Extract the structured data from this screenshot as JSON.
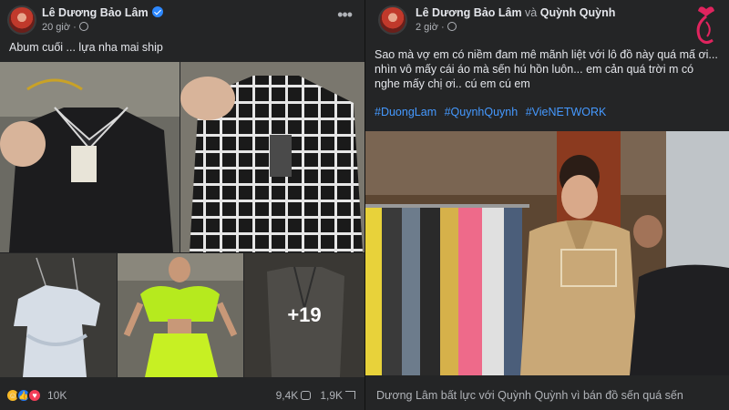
{
  "left_post": {
    "author": "Lê Dương Bảo Lâm",
    "time": "20 giờ ·",
    "caption": "Abum cuối ... lựa nha mai ship",
    "more_overlay": "+19",
    "reaction_count": "10K",
    "comment_count": "9,4K",
    "share_count": "1,9K",
    "reaction_icons": [
      "haha",
      "like",
      "love"
    ]
  },
  "right_post": {
    "author": "Lê Dương Bảo Lâm",
    "and": "và",
    "coauthor": "Quỳnh Quỳnh",
    "time": "2 giờ ·",
    "caption": "Sao mà vợ em có niềm đam mê mãnh liệt với lô đồ này quá mấ ơi... nhìn vô mấy cái áo mà sến hú hồn luôn... em cản quá trời m có nghe mấy chị ơi.. cú em cú em",
    "hashtags": [
      "#DuongLam",
      "#QuynhQuynh",
      "#VieNETWORK"
    ],
    "headline": "Dương Lâm bất lực với Quỳnh Quỳnh vì bán đồ sến quá sến"
  },
  "colors": {
    "bg": "#242526",
    "text": "#e4e6eb",
    "muted": "#b0b3b8",
    "link": "#4599ff",
    "verified": "#2d88ff"
  }
}
